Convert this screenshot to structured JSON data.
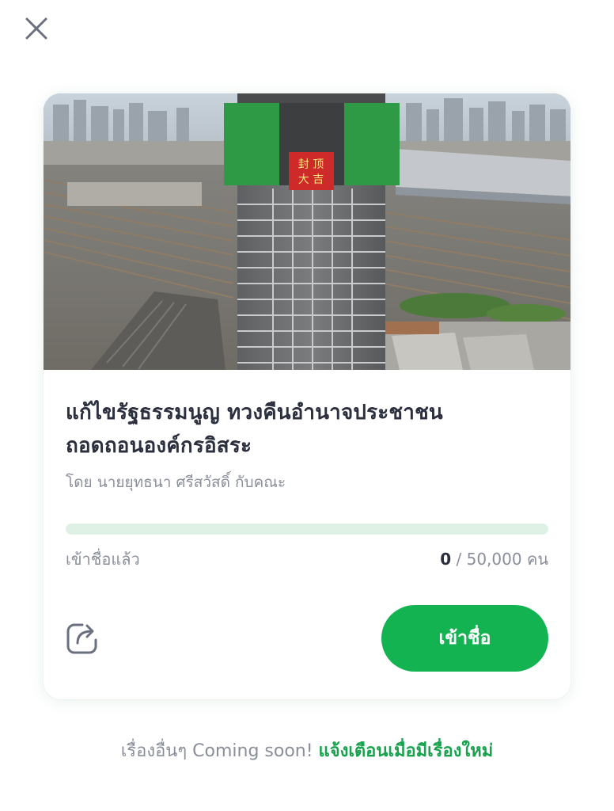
{
  "header": {
    "close_icon": "close-icon"
  },
  "petition": {
    "image_alt": "Aerial view of high-rise building under construction beside rail yard",
    "banner_text": "封顶 大吉",
    "title_line1": "แก้ไขรัฐธรรมนูญ ทวงคืนอำนาจประชาชน",
    "title_line2": "ถอดถอนองค์กรอิสระ",
    "byline": "โดย นายยุทธนา ศรีสวัสดิ์ กับคณะ",
    "progress": 0,
    "signed_label": "เข้าชื่อแล้ว",
    "signed_count": "0",
    "goal_text": " / 50,000 คน",
    "share_icon": "share-icon",
    "sign_button_label": "เข้าชื่อ"
  },
  "footer": {
    "text": "เรื่องอื่นๆ Coming soon! ",
    "link_text": "แจ้งเตือนเมื่อมีเรื่องใหม่"
  },
  "colors": {
    "accent": "#14b352",
    "progress_track": "#dff1e5",
    "title": "#2b2f3e",
    "muted": "#8a8e99"
  }
}
